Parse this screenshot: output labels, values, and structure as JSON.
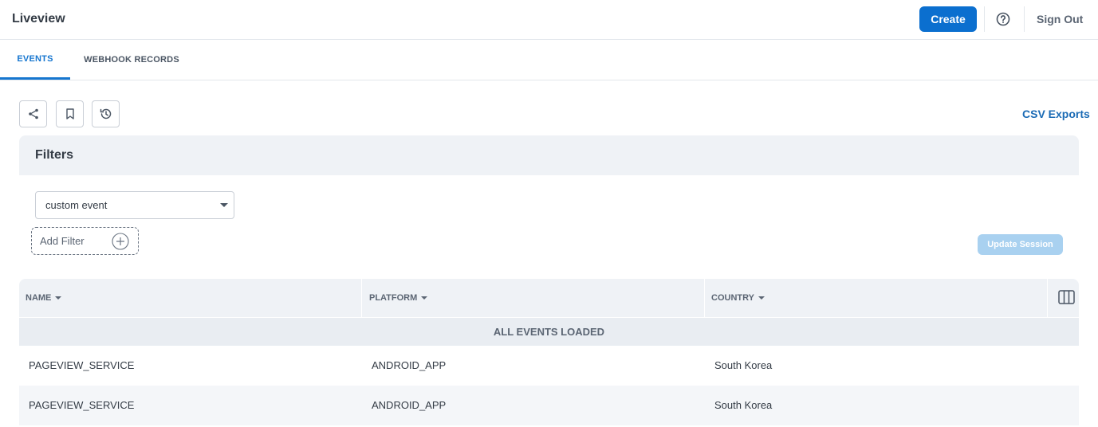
{
  "header": {
    "app_title": "Liveview",
    "create_label": "Create",
    "signout_label": "Sign Out",
    "accent": "#0b6fcf"
  },
  "tabs": [
    {
      "label": "EVENTS",
      "active": true
    },
    {
      "label": "WEBHOOK RECORDS",
      "active": false
    }
  ],
  "toolbar": {
    "icons": [
      "share-icon",
      "bookmark-icon",
      "history-icon"
    ],
    "csv_label": "CSV Exports"
  },
  "filters": {
    "title": "Filters",
    "event_select_value": "custom event",
    "add_filter_label": "Add Filter",
    "update_session_label": "Update Session"
  },
  "table": {
    "columns": [
      "NAME",
      "PLATFORM",
      "COUNTRY"
    ],
    "status_text": "ALL EVENTS LOADED",
    "rows": [
      {
        "name": "PAGEVIEW_SERVICE",
        "platform": "ANDROID_APP",
        "country": "South Korea"
      },
      {
        "name": "PAGEVIEW_SERVICE",
        "platform": "ANDROID_APP",
        "country": "South Korea"
      }
    ]
  }
}
